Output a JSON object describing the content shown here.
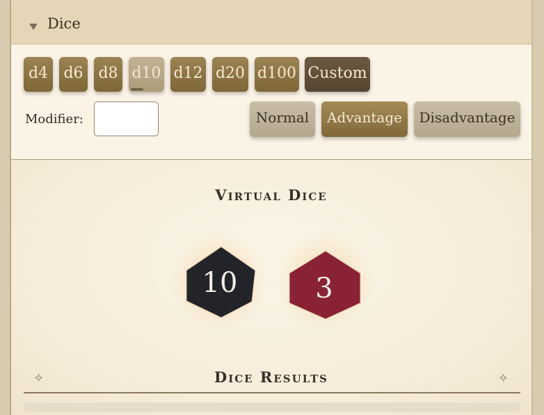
{
  "panel": {
    "title": "Dice"
  },
  "dice_buttons": [
    {
      "label": "d4"
    },
    {
      "label": "d6"
    },
    {
      "label": "d8"
    },
    {
      "label": "d10"
    },
    {
      "label": "d12"
    },
    {
      "label": "d20"
    },
    {
      "label": "d100"
    },
    {
      "label": "Custom"
    }
  ],
  "modifier": {
    "label": "Modifier:",
    "value": ""
  },
  "modes": [
    {
      "label": "Normal"
    },
    {
      "label": "Advantage"
    },
    {
      "label": "Disadvantage"
    }
  ],
  "active_die": "d10",
  "active_mode": "Advantage",
  "virtual_dice": {
    "title": "Virtual Dice",
    "dice": [
      {
        "value": "10",
        "color": "#23232a"
      },
      {
        "value": "3",
        "color": "#8a2236"
      }
    ]
  },
  "results": {
    "title": "Dice Results"
  },
  "colors": {
    "accent": "#8c733f",
    "panel_bg": "#f7eedd",
    "header_bg": "#e4d6b6"
  }
}
